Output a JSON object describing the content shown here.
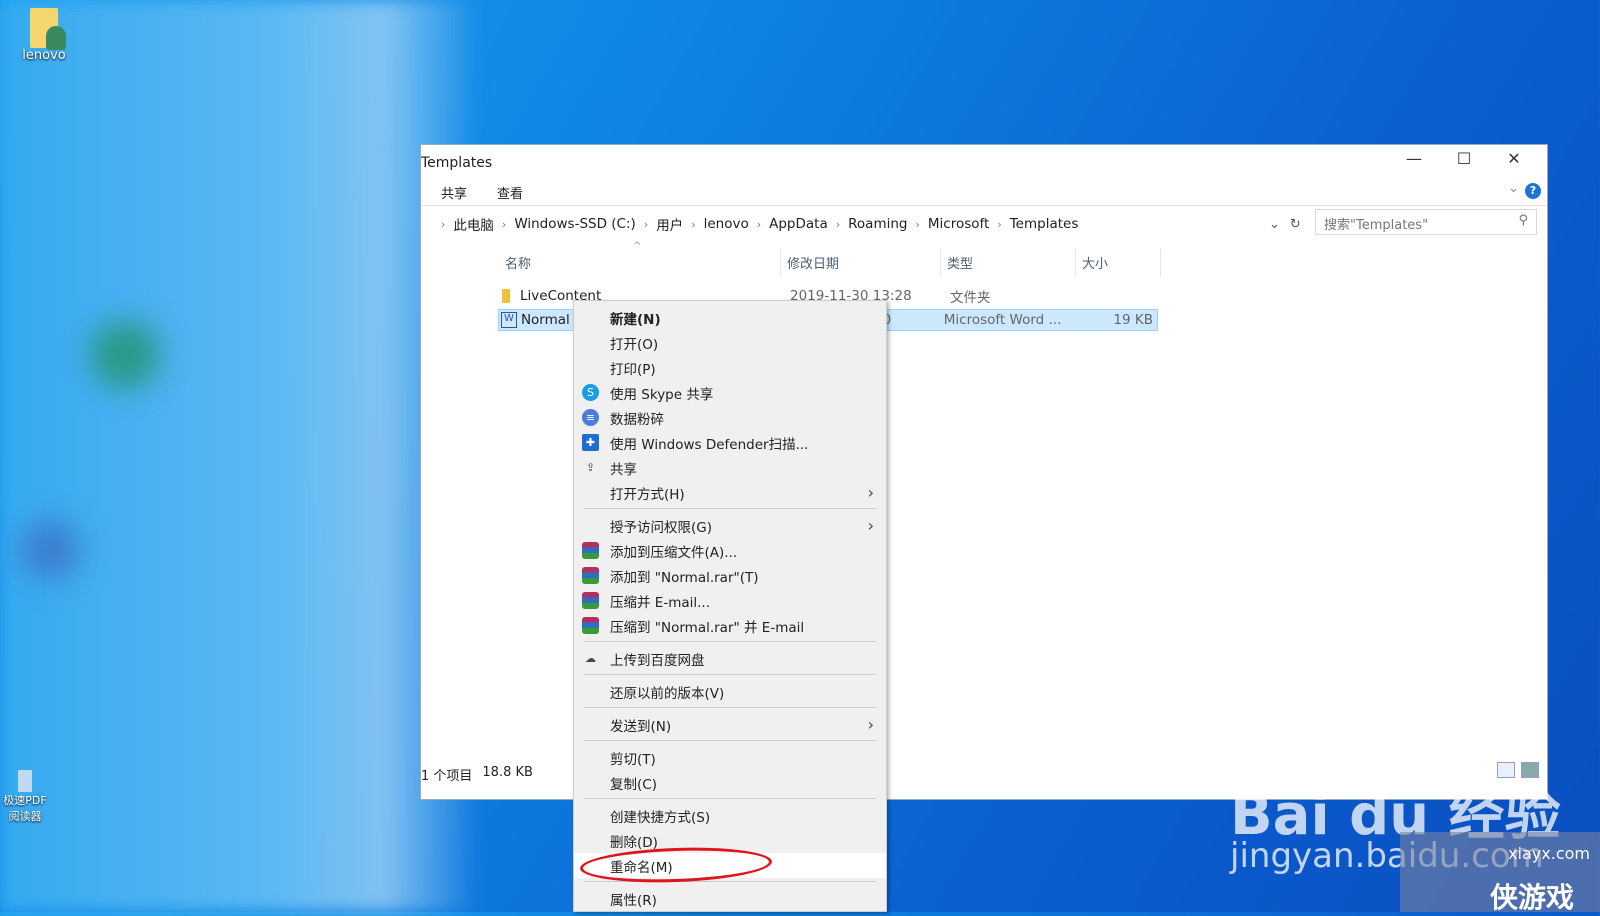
{
  "desktop": {
    "icons": [
      {
        "label": "lenovo"
      },
      {
        "label": "极速PDF阅读器"
      }
    ]
  },
  "window": {
    "title": "Templates",
    "ribbon_tabs": [
      "共享",
      "查看"
    ],
    "controls": {
      "minimize": "—",
      "maximize": "☐",
      "close": "✕",
      "help": "?"
    },
    "breadcrumb": [
      "此电脑",
      "Windows-SSD (C:)",
      "用户",
      "lenovo",
      "AppData",
      "Roaming",
      "Microsoft",
      "Templates"
    ],
    "search_placeholder": "搜索\"Templates\"",
    "columns": [
      "名称",
      "修改日期",
      "类型",
      "大小"
    ],
    "files": [
      {
        "name": "LiveContent",
        "modified": "2019-11-30 13:28",
        "type": "文件夹",
        "size": ""
      },
      {
        "name": "Normal",
        "modified": "00",
        "type": "Microsoft Word ...",
        "size": "19 KB",
        "selected": true
      }
    ],
    "status": {
      "count": "1 个项目",
      "size": "18.8 KB"
    }
  },
  "context_menu": {
    "groups": [
      [
        {
          "label": "新建(N)",
          "bold": true
        },
        {
          "label": "打开(O)"
        },
        {
          "label": "打印(P)"
        },
        {
          "label": "使用 Skype 共享",
          "icon": "skype-icon"
        },
        {
          "label": "数据粉碎",
          "icon": "shred-icon"
        },
        {
          "label": "使用 Windows Defender扫描...",
          "icon": "defender-shield-icon"
        },
        {
          "label": "共享",
          "icon": "share-icon"
        },
        {
          "label": "打开方式(H)",
          "submenu": true
        }
      ],
      [
        {
          "label": "授予访问权限(G)",
          "submenu": true
        },
        {
          "label": "添加到压缩文件(A)...",
          "icon": "winrar-icon"
        },
        {
          "label": "添加到 \"Normal.rar\"(T)",
          "icon": "winrar-icon"
        },
        {
          "label": "压缩并 E-mail...",
          "icon": "winrar-icon"
        },
        {
          "label": "压缩到 \"Normal.rar\" 并 E-mail",
          "icon": "winrar-icon"
        }
      ],
      [
        {
          "label": "上传到百度网盘",
          "icon": "baidu-netdisk-icon"
        }
      ],
      [
        {
          "label": "还原以前的版本(V)"
        }
      ],
      [
        {
          "label": "发送到(N)",
          "submenu": true
        }
      ],
      [
        {
          "label": "剪切(T)"
        },
        {
          "label": "复制(C)"
        }
      ],
      [
        {
          "label": "创建快捷方式(S)"
        },
        {
          "label": "删除(D)"
        },
        {
          "label": "重命名(M)",
          "highlighted": true
        }
      ],
      [
        {
          "label": "属性(R)"
        }
      ]
    ]
  },
  "annotation": {
    "color": "#e0141c"
  },
  "watermarks": {
    "baidu": "Bai du 经验",
    "baidu_url": "jingyan.baidu.com",
    "site": "xiayx.com",
    "site_name": "侠游戏"
  }
}
